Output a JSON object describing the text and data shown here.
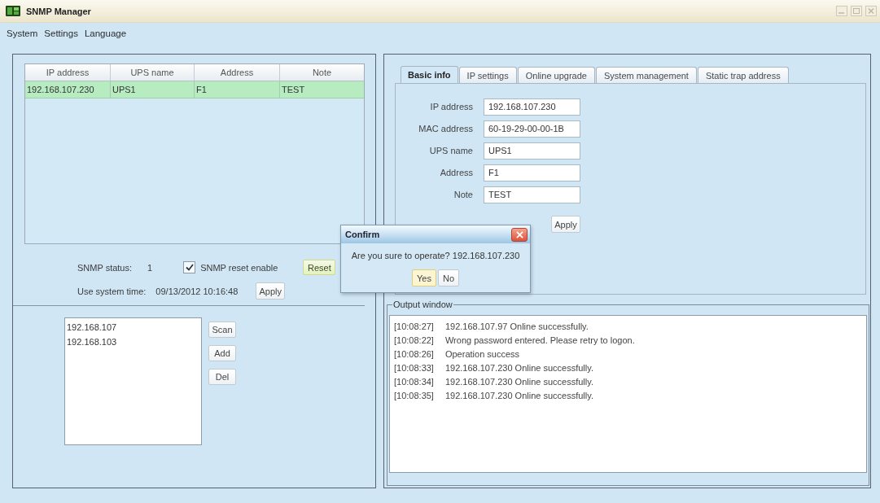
{
  "window": {
    "title": "SNMP Manager"
  },
  "menu": [
    {
      "label": "System"
    },
    {
      "label": "Settings"
    },
    {
      "label": "Language"
    }
  ],
  "device_table": {
    "columns": [
      "IP address",
      "UPS name",
      "Address",
      "Note"
    ],
    "rows": [
      {
        "cells": [
          "192.168.107.230",
          "UPS1",
          "F1",
          "TEST"
        ],
        "selected": true
      }
    ]
  },
  "snmp_status": {
    "label": "SNMP status:",
    "value": "1"
  },
  "reset_enable": {
    "label": "SNMP reset enable",
    "checked": true
  },
  "reset_button": "Reset",
  "system_time": {
    "label": "Use system time:",
    "value": "09/13/2012 10:16:48",
    "button": "Apply"
  },
  "segments": {
    "items": [
      {
        "text": "192.168.107",
        "selected": false
      },
      {
        "text": "192.168.103",
        "selected": false
      }
    ],
    "buttons": [
      "Scan",
      "Add",
      "Del"
    ]
  },
  "tabs": [
    {
      "label": "Basic info",
      "selected": true
    },
    {
      "label": "IP settings",
      "selected": false
    },
    {
      "label": "Online upgrade",
      "selected": false
    },
    {
      "label": "System management",
      "selected": false
    },
    {
      "label": "Static trap address",
      "selected": false
    }
  ],
  "basic_info": {
    "fields": [
      {
        "label": "IP address",
        "value": "192.168.107.230"
      },
      {
        "label": "MAC address",
        "value": "60-19-29-00-00-1B"
      },
      {
        "label": "UPS name",
        "value": "UPS1"
      },
      {
        "label": "Address",
        "value": "F1"
      },
      {
        "label": "Note",
        "value": "TEST"
      }
    ],
    "button": "Apply"
  },
  "output_window": {
    "title": "Output window",
    "lines": [
      {
        "time": "[10:08:27]",
        "message": "192.168.107.97 Online successfully."
      },
      {
        "time": "[10:08:22]",
        "message": "Wrong password entered. Please retry to logon."
      },
      {
        "time": "[10:08:26]",
        "message": "Operation success"
      },
      {
        "time": "[10:08:33]",
        "message": "192.168.107.230 Online successfully."
      },
      {
        "time": "[10:08:34]",
        "message": "192.168.107.230 Online successfully."
      },
      {
        "time": "[10:08:35]",
        "message": "192.168.107.230 Online successfully."
      }
    ]
  },
  "dialog": {
    "title": "Confirm",
    "message": "Are you sure to operate? 192.168.107.230",
    "buttons": [
      {
        "label": "Yes",
        "focused": true
      },
      {
        "label": "No",
        "focused": false
      }
    ]
  }
}
